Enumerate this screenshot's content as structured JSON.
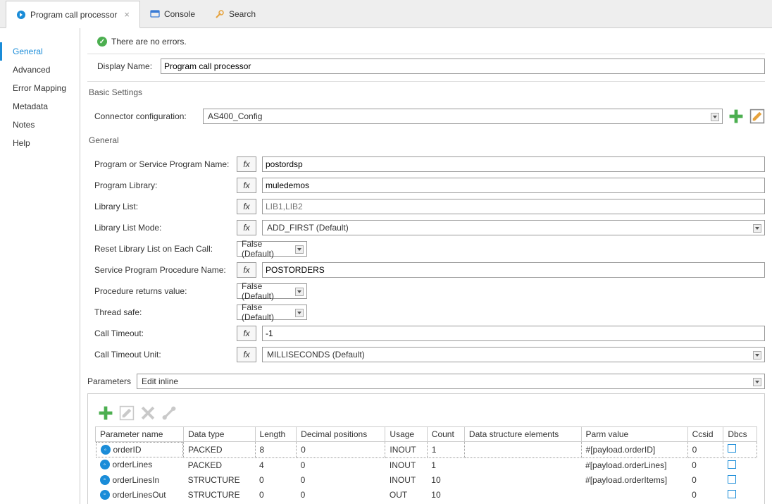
{
  "tabs": [
    {
      "label": "Program call processor",
      "active": true,
      "icon": "connector"
    },
    {
      "label": "Console",
      "active": false,
      "icon": "console"
    },
    {
      "label": "Search",
      "active": false,
      "icon": "search"
    }
  ],
  "sidebar": {
    "items": [
      {
        "label": "General",
        "active": true
      },
      {
        "label": "Advanced",
        "active": false
      },
      {
        "label": "Error Mapping",
        "active": false
      },
      {
        "label": "Metadata",
        "active": false
      },
      {
        "label": "Notes",
        "active": false
      },
      {
        "label": "Help",
        "active": false
      }
    ]
  },
  "status": {
    "text": "There are no errors."
  },
  "displayName": {
    "label": "Display Name:",
    "value": "Program call processor"
  },
  "basicSettings": {
    "legend": "Basic Settings",
    "connectorLabel": "Connector configuration:",
    "connectorValue": "AS400_Config"
  },
  "general": {
    "legend": "General",
    "fields": {
      "programName": {
        "label": "Program or Service Program Name:",
        "value": "postordsp",
        "fx": true
      },
      "programLibrary": {
        "label": "Program Library:",
        "value": "muledemos",
        "fx": true
      },
      "libraryList": {
        "label": "Library List:",
        "placeholder": "LIB1,LIB2",
        "value": "",
        "fx": true
      },
      "libraryListMode": {
        "label": "Library List Mode:",
        "value": "ADD_FIRST (Default)",
        "fx": true,
        "type": "select"
      },
      "resetLibrary": {
        "label": "Reset Library List on Each Call:",
        "value": "False (Default)",
        "type": "small-select"
      },
      "serviceProcedure": {
        "label": "Service Program Procedure Name:",
        "value": "POSTORDERS",
        "fx": true
      },
      "procedureReturns": {
        "label": "Procedure returns value:",
        "value": "False (Default)",
        "type": "small-select"
      },
      "threadSafe": {
        "label": "Thread safe:",
        "value": "False (Default)",
        "type": "small-select"
      },
      "callTimeout": {
        "label": "Call Timeout:",
        "value": "-1",
        "fx": true
      },
      "callTimeoutUnit": {
        "label": "Call Timeout Unit:",
        "value": "MILLISECONDS (Default)",
        "fx": true,
        "type": "select"
      }
    }
  },
  "parameters": {
    "label": "Parameters",
    "mode": "Edit inline",
    "columns": [
      "Parameter name",
      "Data type",
      "Length",
      "Decimal positions",
      "Usage",
      "Count",
      "Data structure elements",
      "Parm value",
      "Ccsid",
      "Dbcs"
    ],
    "rows": [
      {
        "name": "orderID",
        "dataType": "PACKED",
        "length": "8",
        "decimals": "0",
        "usage": "INOUT",
        "count": "1",
        "dse": "",
        "parmValue": "#[payload.orderID]",
        "ccsid": "0",
        "dbcs": false,
        "selected": true
      },
      {
        "name": "orderLines",
        "dataType": "PACKED",
        "length": "4",
        "decimals": "0",
        "usage": "INOUT",
        "count": "1",
        "dse": "",
        "parmValue": "#[payload.orderLines]",
        "ccsid": "0",
        "dbcs": false,
        "selected": false
      },
      {
        "name": "orderLinesIn",
        "dataType": "STRUCTURE",
        "length": "0",
        "decimals": "0",
        "usage": "INOUT",
        "count": "10",
        "dse": "",
        "parmValue": "#[payload.orderItems]",
        "ccsid": "0",
        "dbcs": false,
        "selected": false
      },
      {
        "name": "orderLinesOut",
        "dataType": "STRUCTURE",
        "length": "0",
        "decimals": "0",
        "usage": "OUT",
        "count": "10",
        "dse": "",
        "parmValue": "",
        "ccsid": "0",
        "dbcs": false,
        "selected": false
      }
    ]
  },
  "fxLabel": "fx"
}
